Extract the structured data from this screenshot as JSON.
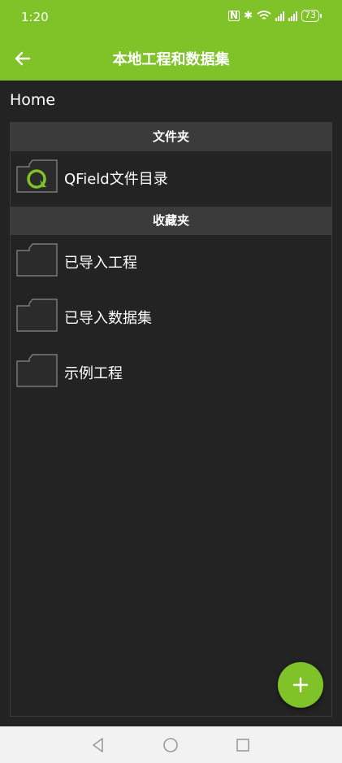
{
  "status_bar": {
    "time": "1:20",
    "battery": "73",
    "nfc": "N",
    "bluetooth": "✱"
  },
  "app_bar": {
    "title": "本地工程和数据集",
    "back_icon": "arrow-left-icon"
  },
  "breadcrumb": "Home",
  "sections": {
    "folders_header": "文件夹",
    "favorites_header": "收藏夹"
  },
  "folders": [
    {
      "label": "QField文件目录",
      "icon": "qfield-logo-icon"
    }
  ],
  "favorites": [
    {
      "label": "已导入工程",
      "icon": "folder-icon"
    },
    {
      "label": "已导入数据集",
      "icon": "folder-icon"
    },
    {
      "label": "示例工程",
      "icon": "folder-icon"
    }
  ],
  "fab": {
    "label": "+",
    "icon": "plus-icon"
  },
  "colors": {
    "accent": "#80c329",
    "background": "#232323",
    "header": "#3b3b3b",
    "nav_bar": "#f2f2f2"
  }
}
